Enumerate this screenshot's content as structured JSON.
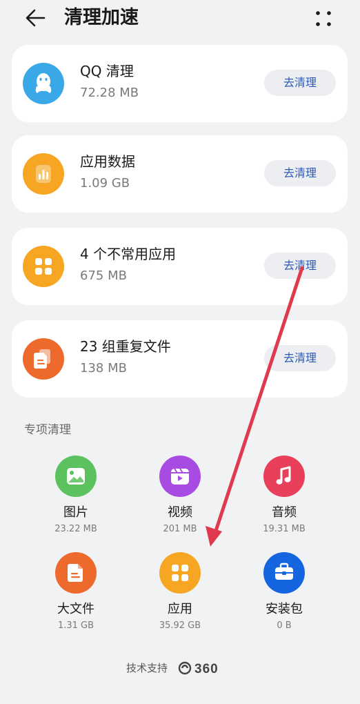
{
  "header": {
    "title": "清理加速",
    "back_icon": "arrow-left-icon",
    "more_icon": "four-dots-icon"
  },
  "cards": [
    {
      "name": "QQ 清理",
      "size": "72.28 MB",
      "button": "去清理",
      "icon": "qq-icon",
      "color": "#3aa8e6"
    },
    {
      "name": "应用数据",
      "size": "1.09 GB",
      "button": "去清理",
      "icon": "bar-chart-icon",
      "color": "#f6a623"
    },
    {
      "name": "4 个不常用应用",
      "size": "675 MB",
      "button": "去清理",
      "icon": "app-grid-icon",
      "color": "#f6a623"
    },
    {
      "name": "23 组重复文件",
      "size": "138 MB",
      "button": "去清理",
      "icon": "documents-icon",
      "color": "#ee6a2c"
    }
  ],
  "special": {
    "label": "专项清理",
    "items": [
      {
        "name": "图片",
        "size": "23.22 MB",
        "icon": "image-icon",
        "color": "#5cc15f"
      },
      {
        "name": "视频",
        "size": "201 MB",
        "icon": "video-icon",
        "color": "#a84be3"
      },
      {
        "name": "音频",
        "size": "19.31 MB",
        "icon": "music-note-icon",
        "color": "#e8405a"
      },
      {
        "name": "大文件",
        "size": "1.31 GB",
        "icon": "file-icon",
        "color": "#ee6a2c"
      },
      {
        "name": "应用",
        "size": "35.92 GB",
        "icon": "app-grid-icon",
        "color": "#f6a623"
      },
      {
        "name": "安装包",
        "size": "0 B",
        "icon": "toolbox-icon",
        "color": "#1565e0"
      }
    ]
  },
  "footer": {
    "text": "技术支持",
    "logo": "360"
  },
  "accent_color": "#2d5bb5",
  "annotation_arrow_color": "#e03a4e"
}
